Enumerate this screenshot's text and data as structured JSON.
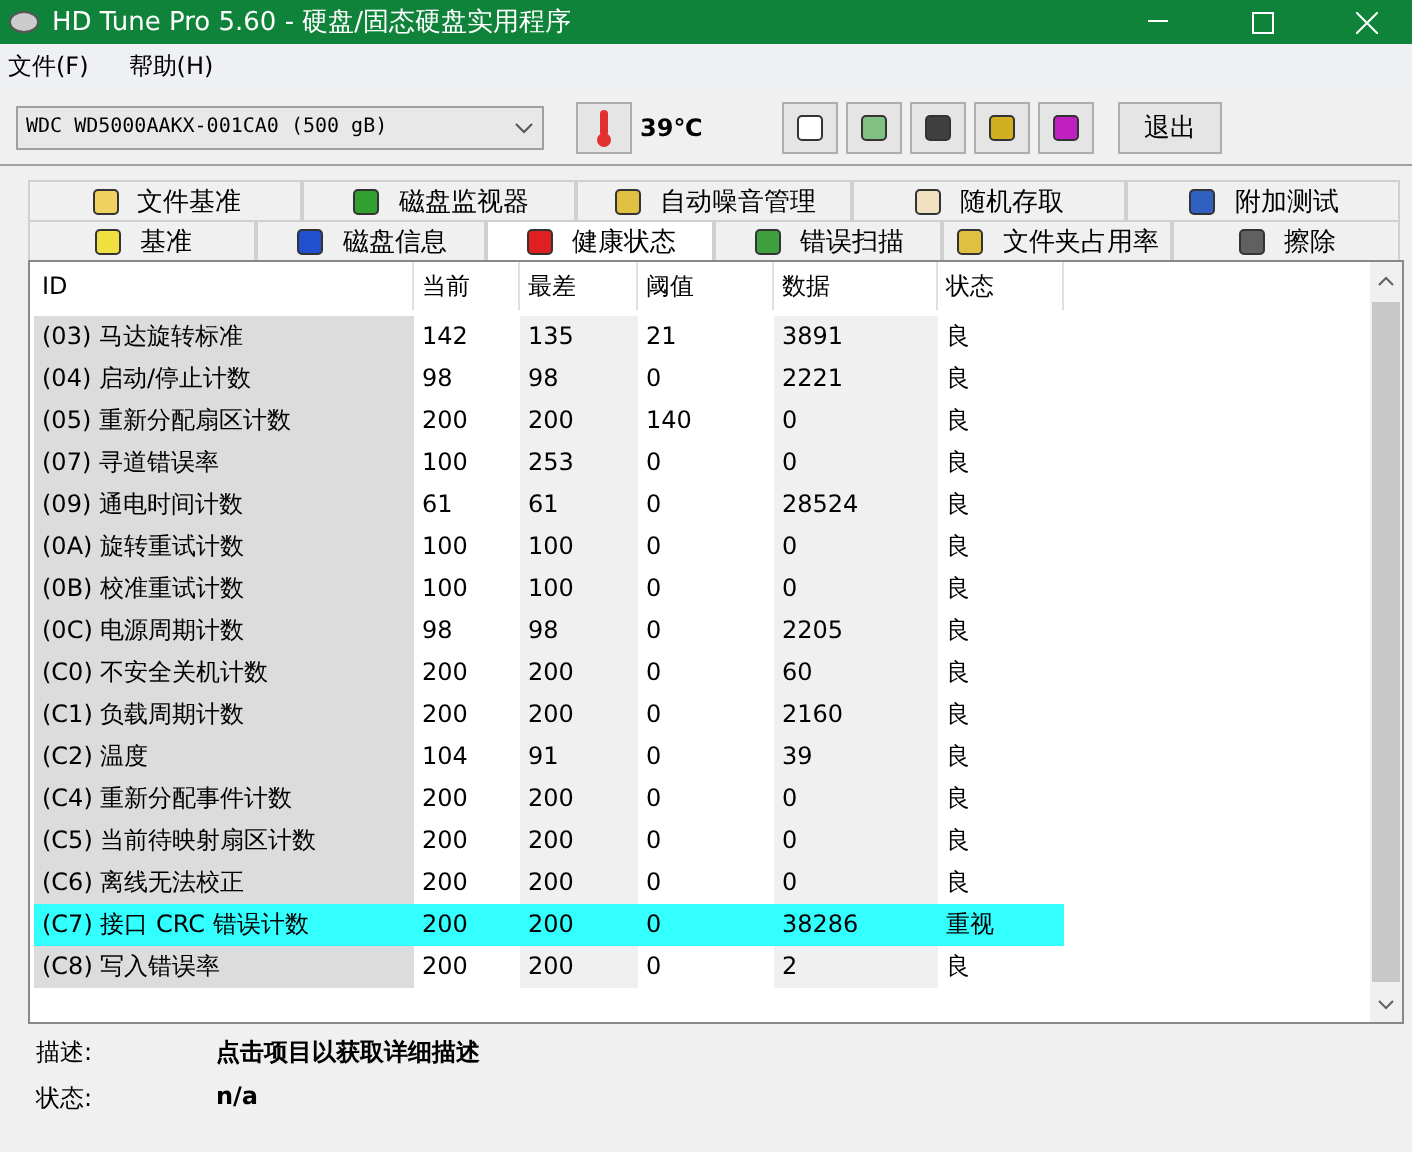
{
  "window": {
    "title": "HD Tune Pro 5.60 - 硬盘/固态硬盘实用程序"
  },
  "menu": [
    "文件(F)",
    "帮助(H)"
  ],
  "toolbar": {
    "drive": "WDC WD5000AAKX-001CA0 (500 gB)",
    "temperature": "39℃",
    "exit": "退出"
  },
  "tabs": [
    [
      {
        "label": "文件基准",
        "selected": false
      },
      {
        "label": "磁盘监视器",
        "selected": false
      },
      {
        "label": "自动噪音管理",
        "selected": false
      },
      {
        "label": "随机存取",
        "selected": false
      },
      {
        "label": "附加测试",
        "selected": false
      }
    ],
    [
      {
        "label": "基准",
        "selected": false
      },
      {
        "label": "磁盘信息",
        "selected": false
      },
      {
        "label": "健康状态",
        "selected": true
      },
      {
        "label": "错误扫描",
        "selected": false
      },
      {
        "label": "文件夹占用率",
        "selected": false
      },
      {
        "label": "擦除",
        "selected": false
      }
    ]
  ],
  "table": {
    "columns": [
      "ID",
      "当前",
      "最差",
      "阈值",
      "数据",
      "状态"
    ],
    "rows": [
      {
        "cells": [
          "(03) 马达旋转标准",
          "142",
          "135",
          "21",
          "3891",
          "良"
        ],
        "selected": false
      },
      {
        "cells": [
          "(04) 启动/停止计数",
          "98",
          "98",
          "0",
          "2221",
          "良"
        ],
        "selected": false
      },
      {
        "cells": [
          "(05) 重新分配扇区计数",
          "200",
          "200",
          "140",
          "0",
          "良"
        ],
        "selected": false
      },
      {
        "cells": [
          "(07) 寻道错误率",
          "100",
          "253",
          "0",
          "0",
          "良"
        ],
        "selected": false
      },
      {
        "cells": [
          "(09) 通电时间计数",
          "61",
          "61",
          "0",
          "28524",
          "良"
        ],
        "selected": false
      },
      {
        "cells": [
          "(0A) 旋转重试计数",
          "100",
          "100",
          "0",
          "0",
          "良"
        ],
        "selected": false
      },
      {
        "cells": [
          "(0B) 校准重试计数",
          "100",
          "100",
          "0",
          "0",
          "良"
        ],
        "selected": false
      },
      {
        "cells": [
          "(0C) 电源周期计数",
          "98",
          "98",
          "0",
          "2205",
          "良"
        ],
        "selected": false
      },
      {
        "cells": [
          "(C0) 不安全关机计数",
          "200",
          "200",
          "0",
          "60",
          "良"
        ],
        "selected": false
      },
      {
        "cells": [
          "(C1) 负载周期计数",
          "200",
          "200",
          "0",
          "2160",
          "良"
        ],
        "selected": false
      },
      {
        "cells": [
          "(C2) 温度",
          "104",
          "91",
          "0",
          "39",
          "良"
        ],
        "selected": false
      },
      {
        "cells": [
          "(C4) 重新分配事件计数",
          "200",
          "200",
          "0",
          "0",
          "良"
        ],
        "selected": false
      },
      {
        "cells": [
          "(C5) 当前待映射扇区计数",
          "200",
          "200",
          "0",
          "0",
          "良"
        ],
        "selected": false
      },
      {
        "cells": [
          "(C6) 离线无法校正",
          "200",
          "200",
          "0",
          "0",
          "良"
        ],
        "selected": false
      },
      {
        "cells": [
          "(C7) 接口 CRC 错误计数",
          "200",
          "200",
          "0",
          "38286",
          "重视"
        ],
        "selected": true
      },
      {
        "cells": [
          "(C8) 写入错误率",
          "200",
          "200",
          "0",
          "2",
          "良"
        ],
        "selected": false
      }
    ]
  },
  "details": [
    {
      "label": "描述:",
      "value": "点击项目以获取详细描述"
    },
    {
      "label": "状态:",
      "value": "n/a"
    }
  ]
}
